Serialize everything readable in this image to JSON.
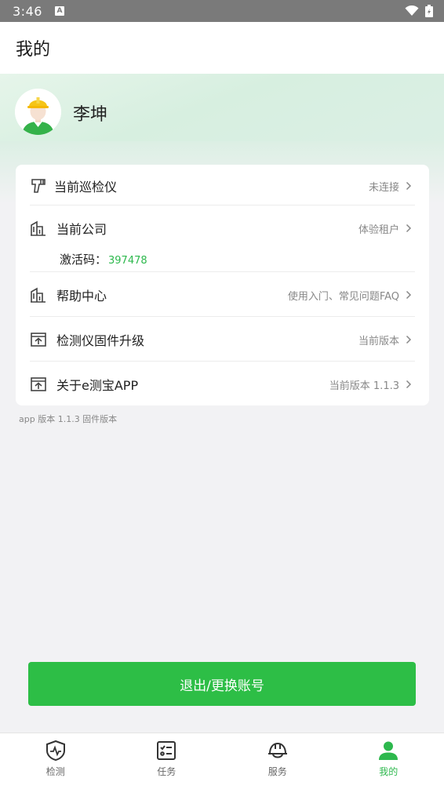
{
  "status_bar": {
    "time": "3:46",
    "notif_badge": "A"
  },
  "header": {
    "title": "我的"
  },
  "user": {
    "name": "李坤"
  },
  "settings": {
    "items": [
      {
        "label": "当前巡检仪",
        "value": "未连接",
        "icon": "inspection-device-icon"
      },
      {
        "label": "当前公司",
        "value": "体验租户",
        "icon": "building-icon"
      },
      {
        "label": "帮助中心",
        "value": "使用入门、常见问题FAQ",
        "icon": "building-icon"
      },
      {
        "label": "检测仪固件升级",
        "value": "当前版本",
        "icon": "upgrade-icon"
      },
      {
        "label": "关于e测宝APP",
        "value": "当前版本 1.1.3",
        "icon": "upgrade-icon"
      }
    ],
    "activation_label": "激活码：",
    "activation_code": "397478"
  },
  "version_note": "app 版本 1.1.3 固件版本",
  "logout_label": "退出/更换账号",
  "tabs": [
    {
      "label": "检测",
      "icon": "shield-pulse-icon"
    },
    {
      "label": "任务",
      "icon": "checklist-icon"
    },
    {
      "label": "服务",
      "icon": "helmet-icon"
    },
    {
      "label": "我的",
      "icon": "person-icon",
      "active": true
    }
  ],
  "colors": {
    "accent": "#2db84d",
    "button": "#2dbe46",
    "status_bar": "#7a7a7a"
  }
}
